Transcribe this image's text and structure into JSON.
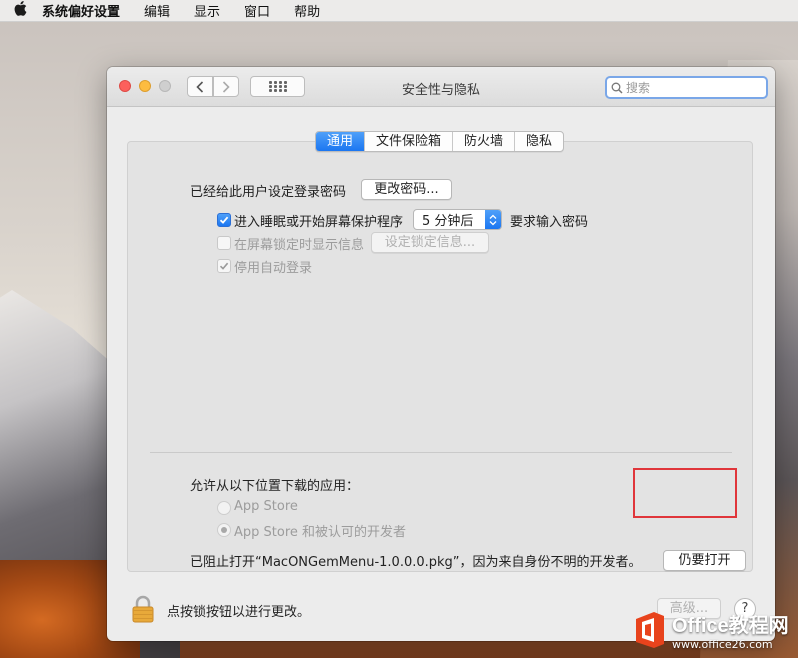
{
  "menubar": {
    "app_name": "系统偏好设置",
    "items": [
      "编辑",
      "显示",
      "窗口",
      "帮助"
    ]
  },
  "window": {
    "title": "安全性与隐私",
    "search_placeholder": "搜索"
  },
  "tabs": [
    {
      "label": "通用",
      "active": true
    },
    {
      "label": "文件保险箱",
      "active": false
    },
    {
      "label": "防火墙",
      "active": false
    },
    {
      "label": "隐私",
      "active": false
    }
  ],
  "general": {
    "password_label": "已经给此用户设定登录密码",
    "change_password_button": "更改密码...",
    "require_password": {
      "checked": true,
      "label": "进入睡眠或开始屏幕保护程序",
      "delay_value": "5 分钟后",
      "suffix": "要求输入密码"
    },
    "lock_message": {
      "checked": false,
      "label": "在屏幕锁定时显示信息",
      "button": "设定锁定信息..."
    },
    "disable_auto_login": {
      "checked": true,
      "label": "停用自动登录"
    },
    "allow_apps_label": "允许从以下位置下载的应用：",
    "sources": [
      {
        "label": "App Store",
        "selected": false
      },
      {
        "label": "App Store 和被认可的开发者",
        "selected": true
      }
    ],
    "blocked_message": "已阻止打开“MacONGemMenu-1.0.0.0.pkg”，因为来自身份不明的开发者。",
    "open_anyway_button": "仍要打开"
  },
  "footer": {
    "lock_text": "点按锁按钮以进行更改。",
    "advanced_button": "高级...",
    "help_button": "?"
  },
  "watermark": {
    "line1": "Office教程网",
    "line2": "www.office26.com"
  },
  "colors": {
    "accent": "#1b76f1",
    "highlight_border": "#e0363b"
  }
}
